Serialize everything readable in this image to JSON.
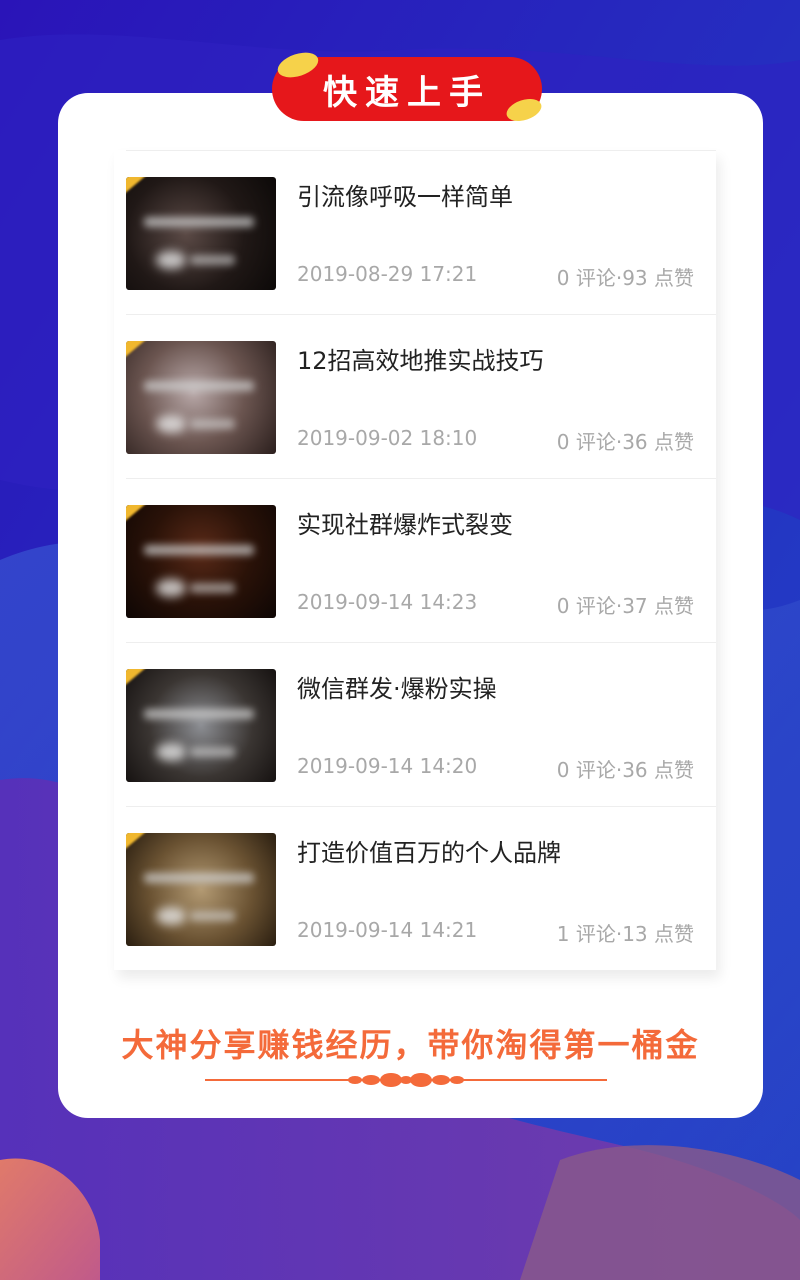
{
  "header": {
    "title": "快速上手"
  },
  "articles": [
    {
      "title": "引流像呼吸一样简单",
      "date": "2019-08-29 17:21",
      "stats": "0 评论·93 点赞"
    },
    {
      "title": "12招高效地推实战技巧",
      "date": "2019-09-02 18:10",
      "stats": "0 评论·36 点赞"
    },
    {
      "title": "实现社群爆炸式裂变",
      "date": "2019-09-14 14:23",
      "stats": "0 评论·37 点赞"
    },
    {
      "title": "微信群发·爆粉实操",
      "date": "2019-09-14 14:20",
      "stats": "0 评论·36 点赞"
    },
    {
      "title": "打造价值百万的个人品牌",
      "date": "2019-09-14 14:21",
      "stats": "1 评论·13 点赞"
    }
  ],
  "footer": {
    "slogan": "大神分享赚钱经历，带你淘得第一桶金"
  },
  "colors": {
    "background": "#2a1fb0",
    "banner": "#e6171b",
    "coin": "#f6d24a",
    "slogan": "#f46a3a",
    "title_text": "#222222",
    "meta_text": "#a8a8a8"
  }
}
